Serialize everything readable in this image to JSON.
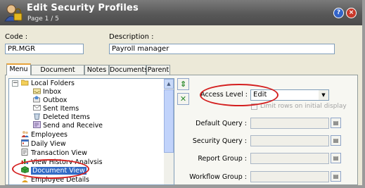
{
  "window": {
    "title": "Edit Security Profiles",
    "subtitle": "Page 1 / 5",
    "help_glyph": "?",
    "close_glyph": "×"
  },
  "code": {
    "label": "Code :",
    "value": "PR.MGR"
  },
  "description": {
    "label": "Description :",
    "value": "Payroll manager"
  },
  "tabs": [
    "Menu",
    "Document Folders",
    "Notes",
    "Documents",
    "Parent"
  ],
  "tree": {
    "items": [
      {
        "label": "Local Folders",
        "icon": "folder-open-icon"
      },
      {
        "label": "Inbox",
        "icon": "inbox-icon"
      },
      {
        "label": "Outbox",
        "icon": "outbox-icon"
      },
      {
        "label": "Sent Items",
        "icon": "sent-items-icon"
      },
      {
        "label": "Deleted Items",
        "icon": "deleted-items-icon"
      },
      {
        "label": "Send and Receive",
        "icon": "send-receive-icon"
      },
      {
        "label": "Employees",
        "icon": "employees-icon"
      },
      {
        "label": "Daily View",
        "icon": "daily-view-icon"
      },
      {
        "label": "Transaction View",
        "icon": "transaction-view-icon"
      },
      {
        "label": "View History Analysis",
        "icon": "history-icon"
      },
      {
        "label": "Document View",
        "icon": "document-view-icon"
      },
      {
        "label": "Employee Details",
        "icon": "employee-details-icon"
      }
    ],
    "expander_glyph": "−"
  },
  "side_buttons": {
    "refresh_glyph": "⇕",
    "remove_glyph": "✕"
  },
  "access_level": {
    "label": "Access Level :",
    "value": "Edit"
  },
  "limit_rows": {
    "label": "Limit rows on initial display",
    "checked": false
  },
  "fields": [
    {
      "label": "Default Query :",
      "value": ""
    },
    {
      "label": "Security Query :",
      "value": ""
    },
    {
      "label": "Report Group :",
      "value": ""
    },
    {
      "label": "Workflow Group :",
      "value": ""
    }
  ],
  "colors": {
    "title_bar": "#595959",
    "selection": "#316ac5",
    "annotation_ellipse": "#d41f1f",
    "tab_active_accent": "#e8a33c"
  }
}
